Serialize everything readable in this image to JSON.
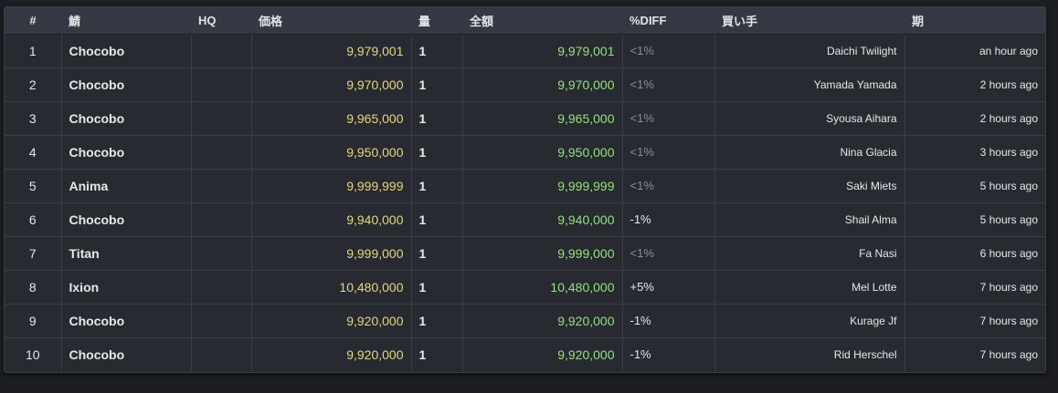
{
  "columns": {
    "num": "#",
    "server": "鯖",
    "hq": "HQ",
    "price": "価格",
    "qty": "量",
    "total": "全額",
    "diff": "%DIFF",
    "buyer": "買い手",
    "date": "期"
  },
  "rows": [
    {
      "num": "1",
      "server": "Chocobo",
      "hq": "",
      "price": "9,979,001",
      "qty": "1",
      "total": "9,979,001",
      "diff": "<1%",
      "buyer": "Daichi Twilight",
      "date": "an hour ago"
    },
    {
      "num": "2",
      "server": "Chocobo",
      "hq": "",
      "price": "9,970,000",
      "qty": "1",
      "total": "9,970,000",
      "diff": "<1%",
      "buyer": "Yamada Yamada",
      "date": "2 hours ago"
    },
    {
      "num": "3",
      "server": "Chocobo",
      "hq": "",
      "price": "9,965,000",
      "qty": "1",
      "total": "9,965,000",
      "diff": "<1%",
      "buyer": "Syousa Aihara",
      "date": "2 hours ago"
    },
    {
      "num": "4",
      "server": "Chocobo",
      "hq": "",
      "price": "9,950,000",
      "qty": "1",
      "total": "9,950,000",
      "diff": "<1%",
      "buyer": "Nina Glacia",
      "date": "3 hours ago"
    },
    {
      "num": "5",
      "server": "Anima",
      "hq": "",
      "price": "9,999,999",
      "qty": "1",
      "total": "9,999,999",
      "diff": "<1%",
      "buyer": "Saki Miets",
      "date": "5 hours ago"
    },
    {
      "num": "6",
      "server": "Chocobo",
      "hq": "",
      "price": "9,940,000",
      "qty": "1",
      "total": "9,940,000",
      "diff": "-1%",
      "buyer": "Shail Alma",
      "date": "5 hours ago"
    },
    {
      "num": "7",
      "server": "Titan",
      "hq": "",
      "price": "9,999,000",
      "qty": "1",
      "total": "9,999,000",
      "diff": "<1%",
      "buyer": "Fa Nasi",
      "date": "6 hours ago"
    },
    {
      "num": "8",
      "server": "Ixion",
      "hq": "",
      "price": "10,480,000",
      "qty": "1",
      "total": "10,480,000",
      "diff": "+5%",
      "buyer": "Mel Lotte",
      "date": "7 hours ago"
    },
    {
      "num": "9",
      "server": "Chocobo",
      "hq": "",
      "price": "9,920,000",
      "qty": "1",
      "total": "9,920,000",
      "diff": "-1%",
      "buyer": "Kurage Jf",
      "date": "7 hours ago"
    },
    {
      "num": "10",
      "server": "Chocobo",
      "hq": "",
      "price": "9,920,000",
      "qty": "1",
      "total": "9,920,000",
      "diff": "-1%",
      "buyer": "Rid Herschel",
      "date": "7 hours ago"
    }
  ],
  "colors": {
    "price": "#e6d77a",
    "total": "#93e27b",
    "diff_muted": "#8a8d93"
  }
}
